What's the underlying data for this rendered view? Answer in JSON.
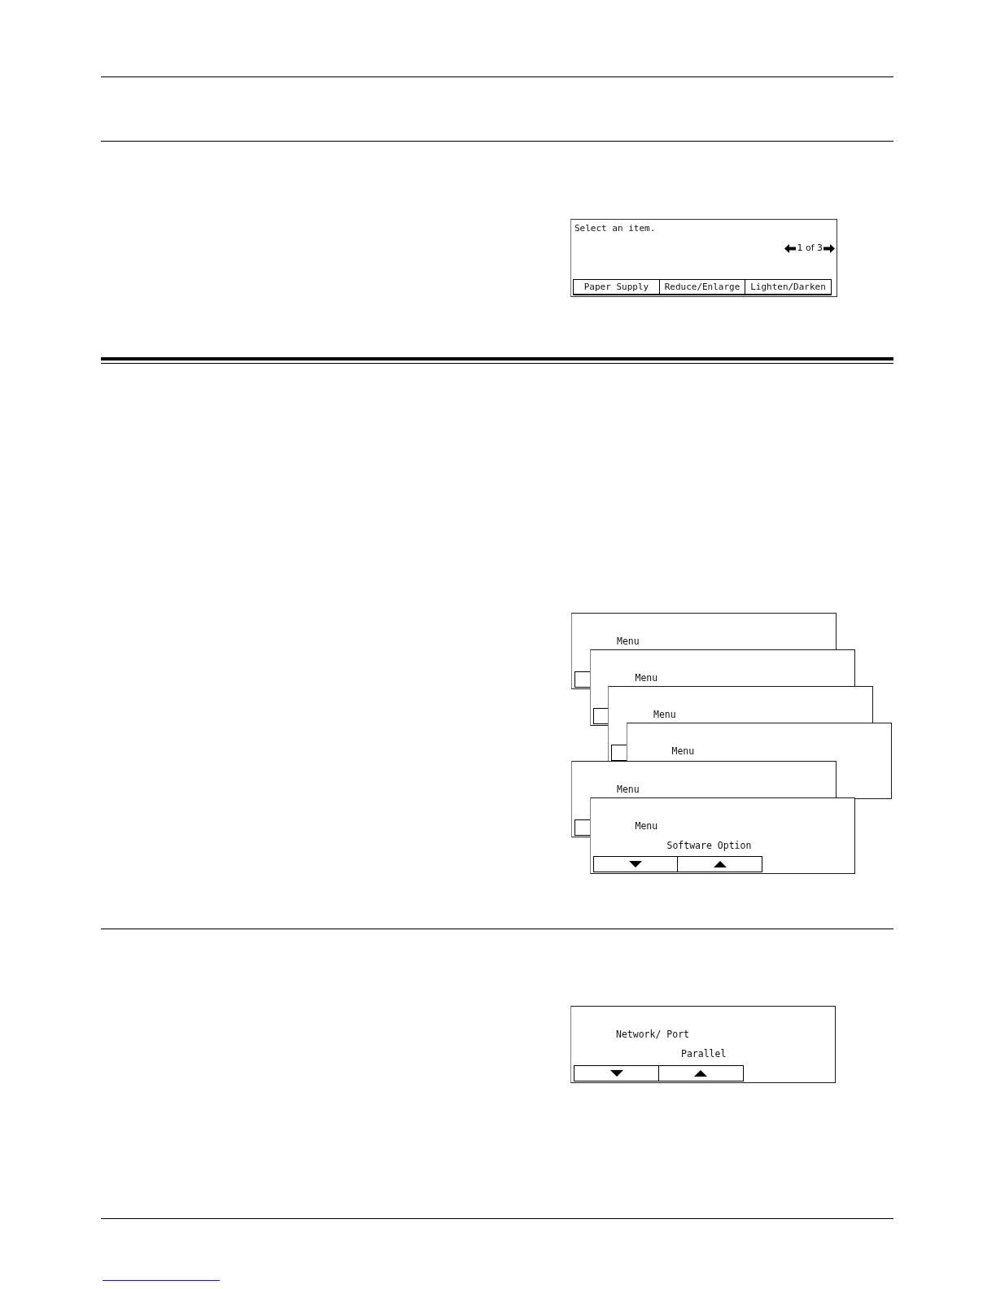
{
  "screens": [
    {
      "kind": "selector",
      "message": "Select an item.",
      "page_indicator": "1 of 3",
      "buttons": [
        "Paper Supply",
        "Reduce/Enlarge",
        "Lighten/Darken"
      ]
    },
    {
      "kind": "stack",
      "groups": [
        {
          "panels": [
            {
              "kind": "covered",
              "title": "Menu"
            },
            {
              "kind": "covered",
              "title": "Menu"
            },
            {
              "kind": "covered",
              "title": "Menu"
            },
            {
              "kind": "plain",
              "title": "Menu"
            }
          ]
        },
        {
          "panels": [
            {
              "kind": "covered",
              "title": "Menu"
            },
            {
              "kind": "front",
              "title": "Menu",
              "value": "Software Option"
            }
          ]
        }
      ]
    },
    {
      "kind": "setting",
      "title": "Network/ Port",
      "value": "Parallel"
    }
  ]
}
